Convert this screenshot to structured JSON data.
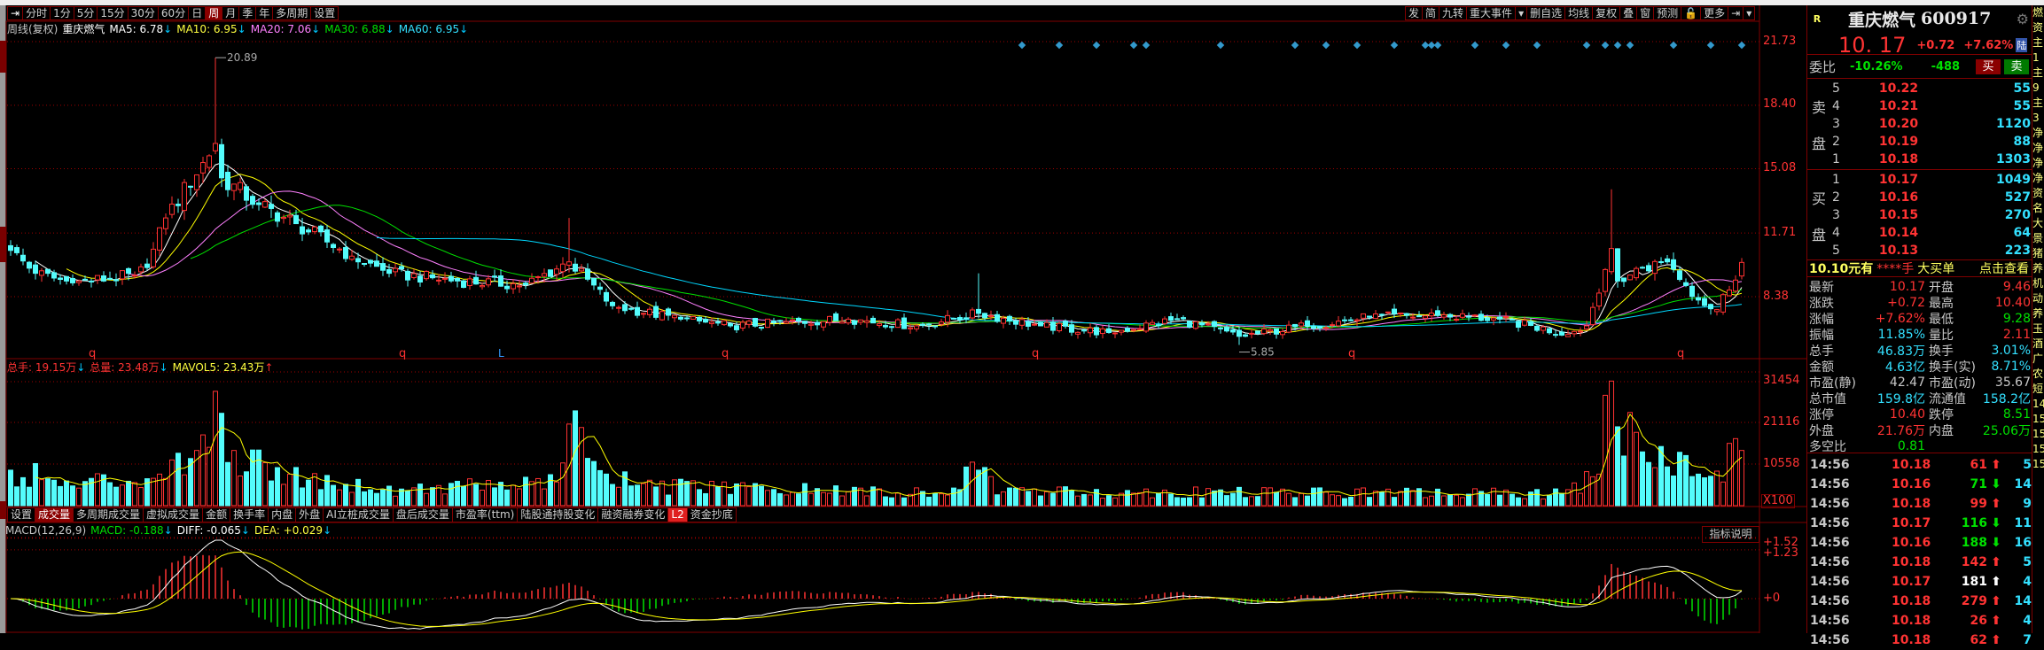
{
  "toolbar": {
    "left_tabs": [
      "分时",
      "1分",
      "5分",
      "15分",
      "30分",
      "60分",
      "日",
      "周",
      "月",
      "季",
      "年",
      "多周期",
      "设置"
    ],
    "active_tab": "周",
    "right_buttons": [
      "发",
      "简",
      "九转",
      "重大事件",
      "▾",
      "删自选",
      "均线",
      "复权",
      "叠",
      "窗",
      "预测",
      "🔓",
      "更多",
      "⇥",
      "▾"
    ]
  },
  "price_header": {
    "period": "周线(复权)",
    "name": "重庆燃气",
    "ma5": "MA5: 6.78",
    "ma10": "MA10: 6.95",
    "ma20": "MA20: 7.06",
    "ma30": "MA30: 6.88",
    "ma60": "MA60: 6.95"
  },
  "volume_header": {
    "total_hand": "总手: 19.15万",
    "total_vol": "总量: 23.48万",
    "mavol5": "MAVOL5: 23.43万"
  },
  "indicator_tabs": [
    "设置",
    "成交量",
    "多周期成交量",
    "虚拟成交量",
    "金额",
    "换手率",
    "内盘",
    "外盘",
    "AI立桩成交量",
    "盘后成交量",
    "市盈率(ttm)",
    "陆股通持股变化",
    "融资融券变化",
    "L2",
    "资金抄底"
  ],
  "indicator_active": "成交量",
  "macd_header": {
    "title": "MACD(12,26,9)",
    "macd": "MACD: -0.188",
    "diff": "DIFF: -0.065",
    "dea": "DEA: +0.029"
  },
  "macd_help": "指标说明",
  "chart_data": {
    "type": "candlestick",
    "title": "重庆燃气 周线(复权)",
    "price_axis": [
      "21.73",
      "18.40",
      "15.08",
      "11.71",
      "8.38"
    ],
    "price_range": [
      5.0,
      21.73
    ],
    "close_keyframes": [
      [
        0,
        10.8
      ],
      [
        4,
        9.6
      ],
      [
        10,
        9.1
      ],
      [
        20,
        9.5
      ],
      [
        22,
        9.9
      ],
      [
        25,
        12.5
      ],
      [
        31,
        15.4
      ],
      [
        33,
        16.4
      ],
      [
        34,
        14.6
      ],
      [
        40,
        13.2
      ],
      [
        46,
        12.2
      ],
      [
        55,
        10.5
      ],
      [
        61,
        9.6
      ],
      [
        72,
        9.2
      ],
      [
        83,
        9.0
      ],
      [
        90,
        10.2
      ],
      [
        97,
        7.9
      ],
      [
        108,
        7.2
      ],
      [
        116,
        6.85
      ],
      [
        135,
        7.2
      ],
      [
        146,
        6.85
      ],
      [
        156,
        7.5
      ],
      [
        166,
        6.85
      ],
      [
        177,
        6.5
      ],
      [
        188,
        7.2
      ],
      [
        198,
        6.3
      ],
      [
        209,
        6.85
      ],
      [
        219,
        7.3
      ],
      [
        230,
        7.4
      ],
      [
        240,
        7.2
      ],
      [
        251,
        6.4
      ],
      [
        254,
        6.85
      ],
      [
        258,
        10.9
      ],
      [
        259,
        9.2
      ],
      [
        263,
        9.9
      ],
      [
        267,
        10.2
      ],
      [
        272,
        8.2
      ],
      [
        275,
        7.7
      ],
      [
        279,
        10.17
      ]
    ],
    "candle_count": 280,
    "high_overrides": {
      "33": 20.89,
      "90": 12.5,
      "156": 9.6,
      "258": 14.0
    },
    "low_overrides": {
      "198": 5.85
    },
    "last_candle": {
      "open": 9.46,
      "high": 10.4,
      "low": 9.28,
      "close": 10.17
    },
    "annotations": {
      "max_label": "20.89",
      "min_label": "5.85"
    },
    "ma_periods": [
      5,
      10,
      20,
      30,
      60
    ],
    "ma_colors": [
      "#ffffff",
      "#ffff00",
      "#ff80ff",
      "#00e000",
      "#00d8ff"
    ],
    "event_markers": [
      163,
      169,
      175,
      181,
      183,
      195,
      207,
      212,
      217,
      223,
      228,
      229,
      230,
      236,
      241,
      246,
      254,
      257,
      259,
      261,
      268,
      274,
      279
    ],
    "q_markers": [
      13,
      63,
      115,
      165,
      216,
      269
    ],
    "q_label": "q",
    "l_markers": [
      79
    ],
    "l_label": "L",
    "volume_axis": [
      "31454",
      "21116",
      "10558"
    ],
    "volume_unit": "X100",
    "volume_keyframes": [
      [
        0,
        9000
      ],
      [
        10,
        5000
      ],
      [
        24,
        8000
      ],
      [
        30,
        14000
      ],
      [
        33,
        29000
      ],
      [
        36,
        14000
      ],
      [
        45,
        8000
      ],
      [
        60,
        4000
      ],
      [
        88,
        6000
      ],
      [
        90,
        20700
      ],
      [
        93,
        12000
      ],
      [
        100,
        5000
      ],
      [
        150,
        3000
      ],
      [
        156,
        9000
      ],
      [
        160,
        3500
      ],
      [
        250,
        3000
      ],
      [
        256,
        8000
      ],
      [
        258,
        31600
      ],
      [
        259,
        20000
      ],
      [
        266,
        15000
      ],
      [
        272,
        8000
      ],
      [
        276,
        6000
      ],
      [
        278,
        17000
      ],
      [
        279,
        14000
      ]
    ],
    "macd_axis": [
      "+1.52",
      "+1.23",
      "+0"
    ],
    "colors": {
      "up": "#ff3232",
      "down": "#54fcfc",
      "macd_up": "#ff3232",
      "macd_down": "#00e000",
      "diff": "#ffffff",
      "dea": "#ffff00",
      "mavol": "#ffff00",
      "marker": "#3399cc"
    }
  },
  "quote": {
    "flag": "R",
    "name": "重庆燃气",
    "code": "600917",
    "price": "10. 17",
    "change": "+0.72",
    "pct": "+7.62%",
    "badge": "陆",
    "weibi_label": "委比",
    "weibi_pct": "-10.26%",
    "weibi_diff": "-488",
    "buy_btn": "买",
    "sell_btn": "卖",
    "sell_side": [
      "卖",
      "盘"
    ],
    "buy_side": [
      "买",
      "盘"
    ],
    "asks": [
      [
        "5",
        "10.22",
        "55"
      ],
      [
        "4",
        "10.21",
        "55"
      ],
      [
        "3",
        "10.20",
        "1120"
      ],
      [
        "2",
        "10.19",
        "88"
      ],
      [
        "1",
        "10.18",
        "1303"
      ]
    ],
    "bids": [
      [
        "1",
        "10.17",
        "1049"
      ],
      [
        "2",
        "10.16",
        "527"
      ],
      [
        "3",
        "10.15",
        "270"
      ],
      [
        "4",
        "10.14",
        "64"
      ],
      [
        "5",
        "10.13",
        "223"
      ]
    ],
    "big_order": {
      "price": "10.10元有",
      "qty": "****手",
      "type": "大买单",
      "link": "点击查看"
    },
    "stats": [
      [
        "最新",
        "10.17",
        "red",
        "开盘",
        "9.46",
        "red"
      ],
      [
        "涨跌",
        "+0.72",
        "red",
        "最高",
        "10.40",
        "red"
      ],
      [
        "涨幅",
        "+7.62%",
        "red",
        "最低",
        "9.28",
        "gr"
      ],
      [
        "振幅",
        "11.85%",
        "cy",
        "量比",
        "2.11",
        "red"
      ],
      [
        "总手",
        "46.83万",
        "cy",
        "换手",
        "3.01%",
        "cy"
      ],
      [
        "金额",
        "4.63亿",
        "cy",
        "换手(实)",
        "8.71%",
        "cy"
      ],
      [
        "市盈(静)",
        "42.47",
        "gy",
        "市盈(动)",
        "35.67",
        "gy"
      ],
      [
        "总市值",
        "159.8亿",
        "cy",
        "流通值",
        "158.2亿",
        "cy"
      ],
      [
        "涨停",
        "10.40",
        "red",
        "跌停",
        "8.51",
        "gr"
      ],
      [
        "外盘",
        "21.76万",
        "red",
        "内盘",
        "25.06万",
        "gr"
      ],
      [
        "多空比",
        "0.81",
        "gr",
        "",
        "",
        ""
      ]
    ],
    "ticks": [
      [
        "14:56",
        "10.18",
        "61",
        "up",
        "5"
      ],
      [
        "14:56",
        "10.16",
        "71",
        "down",
        "14"
      ],
      [
        "14:56",
        "10.18",
        "99",
        "up",
        "9"
      ],
      [
        "14:56",
        "10.17",
        "116",
        "down",
        "11"
      ],
      [
        "14:56",
        "10.16",
        "188",
        "down",
        "16"
      ],
      [
        "14:56",
        "10.18",
        "142",
        "up",
        "5"
      ],
      [
        "14:56",
        "10.17",
        "181",
        "neutral",
        "4"
      ],
      [
        "14:56",
        "10.18",
        "279",
        "up",
        "14"
      ],
      [
        "14:56",
        "10.18",
        "26",
        "up",
        "4"
      ],
      [
        "14:56",
        "10.18",
        "62",
        "up",
        "7"
      ]
    ]
  },
  "side_strip": [
    "燃",
    "资",
    "主",
    "1",
    "主",
    "9",
    "主",
    "3",
    "净",
    "净",
    "净",
    "净",
    "资",
    "名",
    "大",
    "景",
    "猪",
    "养",
    "机",
    "动",
    "养",
    "玉",
    "酒",
    "广",
    "农",
    "短",
    "14",
    "15",
    "15",
    "15",
    "15"
  ]
}
